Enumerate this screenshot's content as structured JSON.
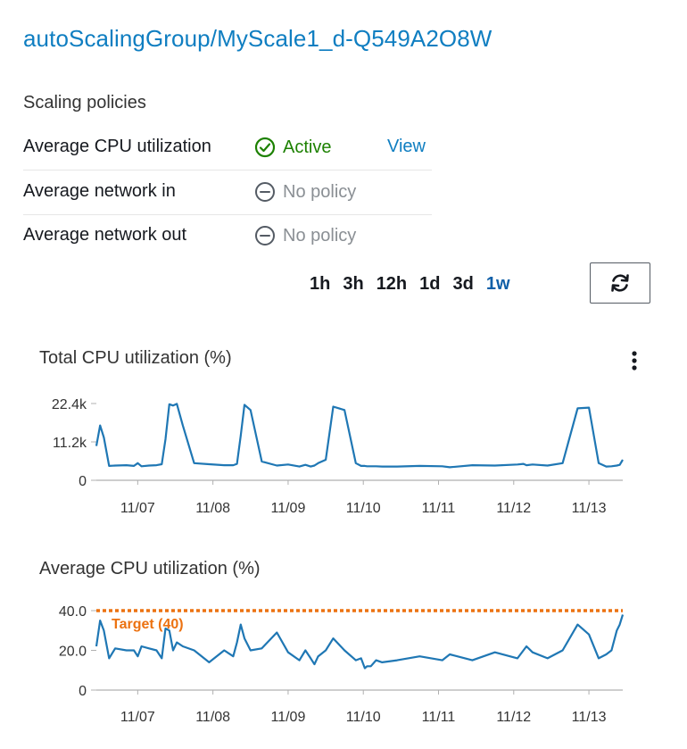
{
  "group": {
    "title": "autoScalingGroup/MyScale1_d-Q549A2O8W"
  },
  "scaling_policies": {
    "label": "Scaling policies",
    "rows": [
      {
        "name": "Average CPU utilization",
        "status": "Active",
        "status_icon": "check-circle-icon",
        "action": "View"
      },
      {
        "name": "Average network in",
        "status": "No policy",
        "status_icon": "minus-circle-icon",
        "action": ""
      },
      {
        "name": "Average network out",
        "status": "No policy",
        "status_icon": "minus-circle-icon",
        "action": ""
      }
    ]
  },
  "time_range": {
    "options": [
      "1h",
      "3h",
      "12h",
      "1d",
      "3d",
      "1w"
    ],
    "selected": "1w"
  },
  "refresh": {
    "icon": "refresh-icon"
  },
  "colors": {
    "link": "#0f7ec1",
    "active": "#1d8102",
    "no_policy": "#8a8f94",
    "series": "#1f77b4",
    "target": "#ec7211"
  },
  "chart_data": [
    {
      "type": "line",
      "title": "Total CPU utilization (%)",
      "xlabel": "",
      "ylabel": "",
      "x_ticks": [
        "11/07",
        "11/08",
        "11/09",
        "11/10",
        "11/11",
        "11/12",
        "11/13"
      ],
      "y_ticks": [
        "0",
        "11.2k",
        "22.4k"
      ],
      "ylim": [
        0,
        22400
      ],
      "xlim": [
        0,
        7
      ],
      "grid": false,
      "series": [
        {
          "x": [
            0.0,
            0.05,
            0.1,
            0.17,
            0.25,
            0.4,
            0.5,
            0.55,
            0.6,
            0.7,
            0.8,
            0.87,
            0.92,
            0.97,
            1.02,
            1.07,
            1.15,
            1.3,
            1.5,
            1.7,
            1.82,
            1.87,
            1.92,
            1.97,
            2.05,
            2.2,
            2.4,
            2.55,
            2.7,
            2.78,
            2.85,
            2.9,
            2.95,
            3.05,
            3.15,
            3.3,
            3.45,
            3.52,
            3.57,
            3.6,
            3.65,
            3.72,
            3.8,
            4.0,
            4.3,
            4.6,
            4.7,
            5.0,
            5.3,
            5.6,
            5.68,
            5.72,
            5.8,
            6.0,
            6.2,
            6.4,
            6.55,
            6.68,
            6.78,
            6.85,
            6.92,
            6.96,
            7.0
          ],
          "values": [
            10000,
            16000,
            12500,
            4200,
            4300,
            4400,
            4200,
            5000,
            4100,
            4300,
            4400,
            4700,
            12000,
            22200,
            21800,
            22300,
            16000,
            5000,
            4700,
            4400,
            4400,
            4800,
            13000,
            22000,
            20500,
            5500,
            4300,
            4600,
            4000,
            4500,
            4000,
            4300,
            5000,
            6000,
            21500,
            20500,
            5000,
            4200,
            4200,
            4100,
            4100,
            4100,
            4000,
            4000,
            4200,
            4100,
            3800,
            4400,
            4300,
            4600,
            4800,
            4400,
            4600,
            4300,
            5000,
            21000,
            21200,
            5000,
            4000,
            4100,
            4300,
            4500,
            6000
          ]
        }
      ]
    },
    {
      "type": "line",
      "title": "Average CPU utilization (%)",
      "xlabel": "",
      "ylabel": "",
      "x_ticks": [
        "11/07",
        "11/08",
        "11/09",
        "11/10",
        "11/11",
        "11/12",
        "11/13"
      ],
      "y_ticks": [
        "0",
        "20.0",
        "40.0"
      ],
      "ylim": [
        0,
        40
      ],
      "xlim": [
        0,
        7
      ],
      "grid": false,
      "annotations": [
        {
          "label": "Target (40)",
          "y": 40
        }
      ],
      "series": [
        {
          "x": [
            0.0,
            0.05,
            0.1,
            0.17,
            0.25,
            0.4,
            0.5,
            0.55,
            0.6,
            0.7,
            0.8,
            0.87,
            0.92,
            0.97,
            1.02,
            1.07,
            1.15,
            1.3,
            1.5,
            1.7,
            1.82,
            1.87,
            1.92,
            1.97,
            2.05,
            2.2,
            2.4,
            2.55,
            2.7,
            2.78,
            2.85,
            2.9,
            2.95,
            3.05,
            3.15,
            3.3,
            3.45,
            3.52,
            3.57,
            3.6,
            3.65,
            3.72,
            3.8,
            4.0,
            4.3,
            4.6,
            4.7,
            5.0,
            5.3,
            5.6,
            5.68,
            5.72,
            5.8,
            6.0,
            6.2,
            6.4,
            6.55,
            6.68,
            6.78,
            6.85,
            6.92,
            6.96,
            7.0
          ],
          "values": [
            22,
            35,
            30,
            16,
            21,
            20,
            20,
            17,
            22,
            21,
            20,
            16,
            31,
            30,
            20,
            24,
            22,
            20,
            14,
            20,
            17,
            24,
            33,
            26,
            20,
            21,
            29,
            19,
            15,
            20,
            16,
            13,
            17,
            20,
            26,
            20,
            15,
            16,
            11,
            12,
            12,
            15,
            14,
            15,
            17,
            15,
            18,
            15,
            19,
            16,
            20,
            22,
            19,
            16,
            20,
            33,
            28,
            16,
            18,
            20,
            30,
            33,
            38
          ]
        }
      ]
    }
  ]
}
